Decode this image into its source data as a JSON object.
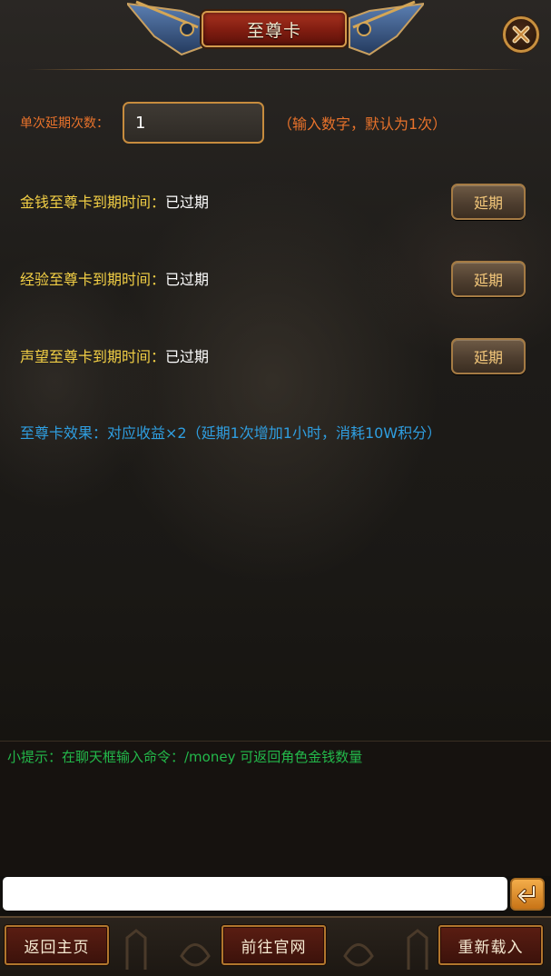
{
  "header": {
    "title": "至尊卡",
    "close_icon": "close-x-icon"
  },
  "extend_count": {
    "label": "单次延期次数：",
    "value": "1",
    "hint": "（输入数字，默认为1次）"
  },
  "cards": [
    {
      "label": "金钱至尊卡到期时间：",
      "status": "已过期",
      "button": "延期"
    },
    {
      "label": "经验至尊卡到期时间：",
      "status": "已过期",
      "button": "延期"
    },
    {
      "label": "声望至尊卡到期时间：",
      "status": "已过期",
      "button": "延期"
    }
  ],
  "effect": "至尊卡效果：对应收益×2（延期1次增加1小时，消耗10W积分）",
  "tip": "小提示：在聊天框输入命令：/money 可返回角色金钱数量",
  "chat": {
    "value": "",
    "send_icon": "enter-arrow-icon"
  },
  "footer": {
    "home": "返回主页",
    "official": "前往官网",
    "reload": "重新载入"
  },
  "colors": {
    "label_orange": "#e8722b",
    "label_yellow": "#f2cf45",
    "effect_blue": "#2f9ee0",
    "tip_green": "#23b84a",
    "title_red": "#8f2415"
  }
}
